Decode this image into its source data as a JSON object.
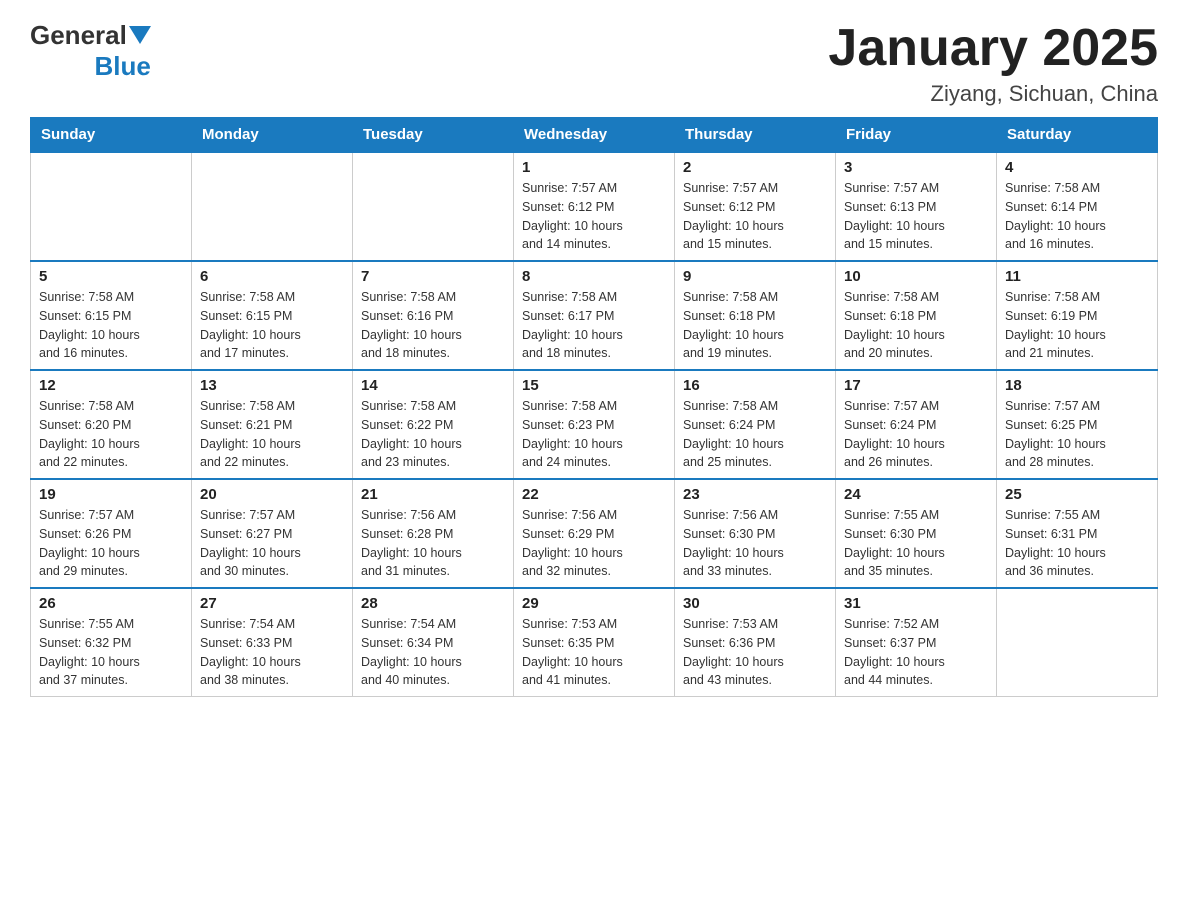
{
  "header": {
    "logo_general": "General",
    "logo_blue": "Blue",
    "title": "January 2025",
    "location": "Ziyang, Sichuan, China"
  },
  "days_of_week": [
    "Sunday",
    "Monday",
    "Tuesday",
    "Wednesday",
    "Thursday",
    "Friday",
    "Saturday"
  ],
  "weeks": [
    [
      {
        "day": "",
        "info": ""
      },
      {
        "day": "",
        "info": ""
      },
      {
        "day": "",
        "info": ""
      },
      {
        "day": "1",
        "info": "Sunrise: 7:57 AM\nSunset: 6:12 PM\nDaylight: 10 hours\nand 14 minutes."
      },
      {
        "day": "2",
        "info": "Sunrise: 7:57 AM\nSunset: 6:12 PM\nDaylight: 10 hours\nand 15 minutes."
      },
      {
        "day": "3",
        "info": "Sunrise: 7:57 AM\nSunset: 6:13 PM\nDaylight: 10 hours\nand 15 minutes."
      },
      {
        "day": "4",
        "info": "Sunrise: 7:58 AM\nSunset: 6:14 PM\nDaylight: 10 hours\nand 16 minutes."
      }
    ],
    [
      {
        "day": "5",
        "info": "Sunrise: 7:58 AM\nSunset: 6:15 PM\nDaylight: 10 hours\nand 16 minutes."
      },
      {
        "day": "6",
        "info": "Sunrise: 7:58 AM\nSunset: 6:15 PM\nDaylight: 10 hours\nand 17 minutes."
      },
      {
        "day": "7",
        "info": "Sunrise: 7:58 AM\nSunset: 6:16 PM\nDaylight: 10 hours\nand 18 minutes."
      },
      {
        "day": "8",
        "info": "Sunrise: 7:58 AM\nSunset: 6:17 PM\nDaylight: 10 hours\nand 18 minutes."
      },
      {
        "day": "9",
        "info": "Sunrise: 7:58 AM\nSunset: 6:18 PM\nDaylight: 10 hours\nand 19 minutes."
      },
      {
        "day": "10",
        "info": "Sunrise: 7:58 AM\nSunset: 6:18 PM\nDaylight: 10 hours\nand 20 minutes."
      },
      {
        "day": "11",
        "info": "Sunrise: 7:58 AM\nSunset: 6:19 PM\nDaylight: 10 hours\nand 21 minutes."
      }
    ],
    [
      {
        "day": "12",
        "info": "Sunrise: 7:58 AM\nSunset: 6:20 PM\nDaylight: 10 hours\nand 22 minutes."
      },
      {
        "day": "13",
        "info": "Sunrise: 7:58 AM\nSunset: 6:21 PM\nDaylight: 10 hours\nand 22 minutes."
      },
      {
        "day": "14",
        "info": "Sunrise: 7:58 AM\nSunset: 6:22 PM\nDaylight: 10 hours\nand 23 minutes."
      },
      {
        "day": "15",
        "info": "Sunrise: 7:58 AM\nSunset: 6:23 PM\nDaylight: 10 hours\nand 24 minutes."
      },
      {
        "day": "16",
        "info": "Sunrise: 7:58 AM\nSunset: 6:24 PM\nDaylight: 10 hours\nand 25 minutes."
      },
      {
        "day": "17",
        "info": "Sunrise: 7:57 AM\nSunset: 6:24 PM\nDaylight: 10 hours\nand 26 minutes."
      },
      {
        "day": "18",
        "info": "Sunrise: 7:57 AM\nSunset: 6:25 PM\nDaylight: 10 hours\nand 28 minutes."
      }
    ],
    [
      {
        "day": "19",
        "info": "Sunrise: 7:57 AM\nSunset: 6:26 PM\nDaylight: 10 hours\nand 29 minutes."
      },
      {
        "day": "20",
        "info": "Sunrise: 7:57 AM\nSunset: 6:27 PM\nDaylight: 10 hours\nand 30 minutes."
      },
      {
        "day": "21",
        "info": "Sunrise: 7:56 AM\nSunset: 6:28 PM\nDaylight: 10 hours\nand 31 minutes."
      },
      {
        "day": "22",
        "info": "Sunrise: 7:56 AM\nSunset: 6:29 PM\nDaylight: 10 hours\nand 32 minutes."
      },
      {
        "day": "23",
        "info": "Sunrise: 7:56 AM\nSunset: 6:30 PM\nDaylight: 10 hours\nand 33 minutes."
      },
      {
        "day": "24",
        "info": "Sunrise: 7:55 AM\nSunset: 6:30 PM\nDaylight: 10 hours\nand 35 minutes."
      },
      {
        "day": "25",
        "info": "Sunrise: 7:55 AM\nSunset: 6:31 PM\nDaylight: 10 hours\nand 36 minutes."
      }
    ],
    [
      {
        "day": "26",
        "info": "Sunrise: 7:55 AM\nSunset: 6:32 PM\nDaylight: 10 hours\nand 37 minutes."
      },
      {
        "day": "27",
        "info": "Sunrise: 7:54 AM\nSunset: 6:33 PM\nDaylight: 10 hours\nand 38 minutes."
      },
      {
        "day": "28",
        "info": "Sunrise: 7:54 AM\nSunset: 6:34 PM\nDaylight: 10 hours\nand 40 minutes."
      },
      {
        "day": "29",
        "info": "Sunrise: 7:53 AM\nSunset: 6:35 PM\nDaylight: 10 hours\nand 41 minutes."
      },
      {
        "day": "30",
        "info": "Sunrise: 7:53 AM\nSunset: 6:36 PM\nDaylight: 10 hours\nand 43 minutes."
      },
      {
        "day": "31",
        "info": "Sunrise: 7:52 AM\nSunset: 6:37 PM\nDaylight: 10 hours\nand 44 minutes."
      },
      {
        "day": "",
        "info": ""
      }
    ]
  ]
}
